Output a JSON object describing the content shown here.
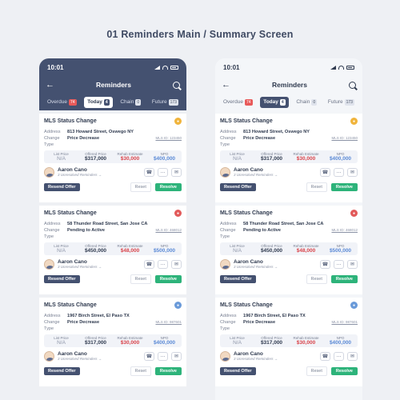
{
  "page_title": "01 Reminders Main / Summary Screen",
  "screen": {
    "time": "10:01",
    "title": "Reminders",
    "back_icon": "arrow-left-icon",
    "search_icon": "search-icon",
    "tabs": [
      {
        "label": "Overdue",
        "count": "74"
      },
      {
        "label": "Today",
        "count": "4"
      },
      {
        "label": "Chain",
        "count": "0"
      },
      {
        "label": "Future",
        "count": "173"
      }
    ],
    "active_tab": "Today",
    "cards": [
      {
        "title": "MLS Status Change",
        "address_label": "Address",
        "address": "813 Howard Street, Oswego NY",
        "change_label": "Change Type",
        "change": "Price Decrease",
        "mls": "MLS ID: 123450",
        "list_price_label": "List Price",
        "list_price": "N/A",
        "offered_label": "Offered Price",
        "offered": "$317,000",
        "rehab_label": "Rehab Estimate",
        "rehab": "$30,000",
        "npo_label": "NPO",
        "npo": "$400,000",
        "name": "Aaron Cano",
        "unresolved": "3 Unresolved Reminders →",
        "resend": "Resend Offer",
        "reset": "Reset",
        "resolve": "Resolve",
        "dot_color": "#f0b43c"
      },
      {
        "title": "MLS Status Change",
        "address_label": "Address",
        "address": "58 Thunder Road Street, San Jose CA",
        "change_label": "Change Type",
        "change": "Pending to Active",
        "mls": "MLS ID: 468012",
        "list_price_label": "List Price",
        "list_price": "N/A",
        "offered_label": "Offered Price",
        "offered": "$450,000",
        "rehab_label": "Rehab Estimate",
        "rehab": "$48,000",
        "npo_label": "NPO",
        "npo": "$500,000",
        "name": "Aaron Cano",
        "unresolved": "3 Unresolved Reminders →",
        "resend": "Resend Offer",
        "reset": "Reset",
        "resolve": "Resolve",
        "dot_color": "#e25a5a"
      },
      {
        "title": "MLS Status Change",
        "address_label": "Address",
        "address": "1967 Birch Street, El Paso TX",
        "change_label": "Change Type",
        "change": "Price Decrease",
        "mls": "MLS ID: 987601",
        "list_price_label": "List Price",
        "list_price": "N/A",
        "offered_label": "Offered Price",
        "offered": "$317,000",
        "rehab_label": "Rehab Estimate",
        "rehab": "$30,000",
        "npo_label": "NPO",
        "npo": "$400,000",
        "name": "Aaron Cano",
        "unresolved": "3 Unresolved Reminders →",
        "resend": "Resend Offer",
        "reset": "Reset",
        "resolve": "Resolve",
        "dot_color": "#6a9ad9"
      }
    ]
  }
}
